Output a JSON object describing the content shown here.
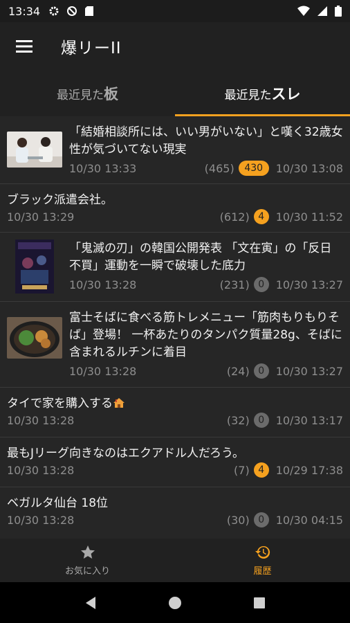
{
  "status": {
    "time": "13:34"
  },
  "app": {
    "title": "爆リーII"
  },
  "tabs": [
    {
      "pre": "最近見た",
      "big": "板"
    },
    {
      "pre": "最近見た",
      "big": "スレ"
    }
  ],
  "threads": [
    {
      "title": "「結婚相談所には、いい男がいない」と嘆く32歳女性が気づいてない現実",
      "visited": "10/30 13:33",
      "count": "(465)",
      "badge": "430",
      "updated": "10/30 13:08",
      "thumb": "meeting-photo"
    },
    {
      "title": "ブラック派遣会社。",
      "visited": "10/30 13:29",
      "count": "(612)",
      "badge": "4",
      "updated": "10/30 11:52"
    },
    {
      "title": "「鬼滅の刃」の韓国公開発表 「文在寅」の「反日不買」運動を一瞬で破壊した底力",
      "visited": "10/30 13:28",
      "count": "(231)",
      "badge": "0",
      "updated": "10/30 13:27",
      "thumb": "movie-poster"
    },
    {
      "title": "富士そばに食べる筋トレメニュー「筋肉もりもりそば」登場！ 一杯あたりのタンパク質量28g、そばに含まれるルチンに着目",
      "visited": "10/30 13:28",
      "count": "(24)",
      "badge": "0",
      "updated": "10/30 13:27",
      "thumb": "soba-photo"
    },
    {
      "title": "タイで家を購入する",
      "visited": "10/30 13:28",
      "count": "(32)",
      "badge": "0",
      "updated": "10/30 13:17",
      "emoji": "house-emoji"
    },
    {
      "title": "最もJリーグ向きなのはエクアドル人だろう。",
      "visited": "10/30 13:28",
      "count": "(7)",
      "badge": "4",
      "updated": "10/29 17:38"
    },
    {
      "title": "ベガルタ仙台 18位",
      "visited": "10/30 13:28",
      "count": "(30)",
      "badge": "0",
      "updated": "10/30 04:15"
    }
  ],
  "bottomnav": [
    {
      "label": "お気に入り",
      "icon": "star-icon"
    },
    {
      "label": "履歴",
      "icon": "history-icon"
    }
  ],
  "colors": {
    "accent": "#f5a11f",
    "badge_zero": "#6b6b6b"
  }
}
